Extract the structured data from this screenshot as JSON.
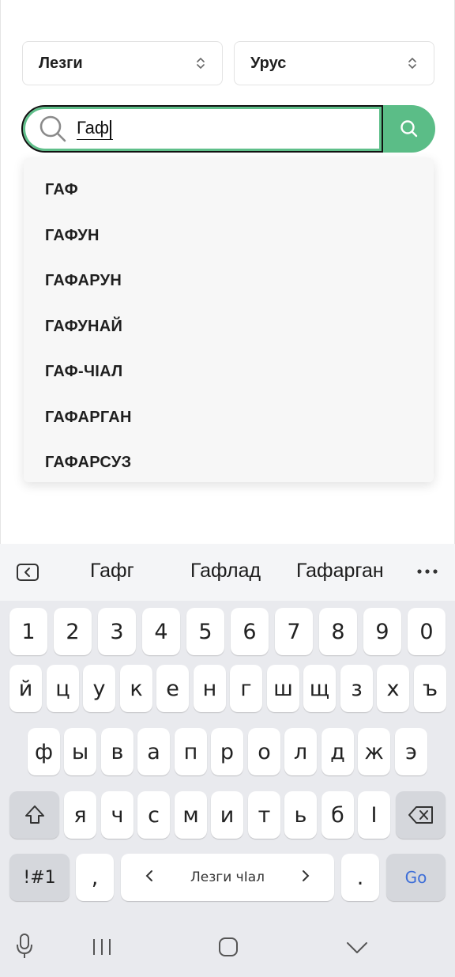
{
  "app": {
    "source_language": "Лезги",
    "target_language": "Урус",
    "search": {
      "value": "Гаф"
    },
    "suggestions": [
      "ГАФ",
      "ГАФУН",
      "ГАФАРУН",
      "ГАФУНАЙ",
      "ГАФ-ЧIАЛ",
      "ГАФАРГАН",
      "ГАФАРСУЗ"
    ]
  },
  "keyboard": {
    "predictions": [
      "Гафг",
      "Гафлад",
      "Гафарган"
    ],
    "row_numbers": [
      "1",
      "2",
      "3",
      "4",
      "5",
      "6",
      "7",
      "8",
      "9",
      "0"
    ],
    "row1": [
      "й",
      "ц",
      "у",
      "к",
      "е",
      "н",
      "г",
      "ш",
      "щ",
      "з",
      "х",
      "ъ"
    ],
    "row2": [
      "ф",
      "ы",
      "в",
      "а",
      "п",
      "р",
      "о",
      "л",
      "д",
      "ж",
      "э"
    ],
    "row3": [
      "я",
      "ч",
      "с",
      "м",
      "и",
      "т",
      "ь",
      "б",
      "І"
    ],
    "symbols_label": "!#1",
    "comma_label": ",",
    "space_label": "Лезги чІал",
    "period_label": ".",
    "go_label": "Go"
  },
  "colors": {
    "accent_green": "#5bbd87",
    "go_blue": "#3f6fd8"
  },
  "icons": {
    "select_arrows": "updown-chevron-icon",
    "search": "magnifier-icon",
    "backspace": "backspace-icon",
    "shift": "shift-icon",
    "mic": "microphone-icon",
    "nav": [
      "recents-icon",
      "home-icon",
      "back-chevron-icon"
    ]
  }
}
